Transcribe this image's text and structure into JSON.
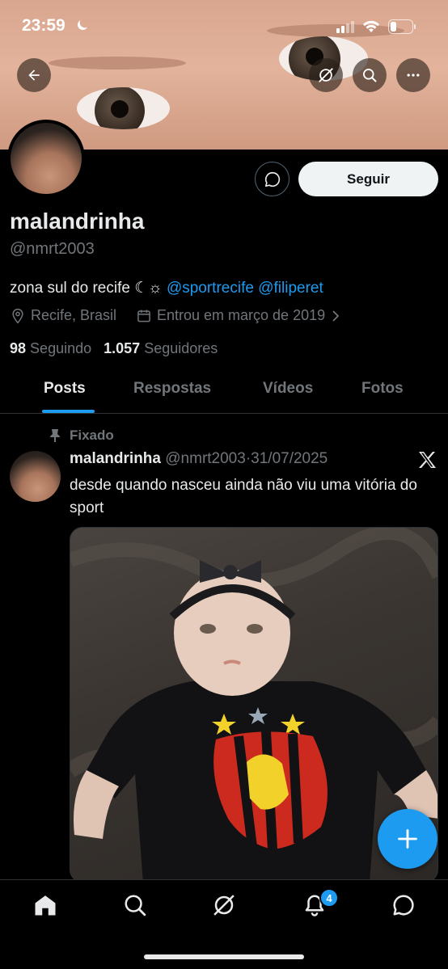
{
  "status_bar": {
    "time": "23:59"
  },
  "profile": {
    "name": "malandrinha",
    "handle": "@nmrt2003",
    "bio_text": "zona sul do recife ☾☼ ",
    "bio_mentions": [
      "@sportrecife",
      "@filiperet"
    ],
    "location": "Recife, Brasil",
    "joined": "Entrou em março de 2019",
    "following_count": "98",
    "following_label": "Seguindo",
    "followers_count": "1.057",
    "followers_label": "Seguidores",
    "follow_label": "Seguir"
  },
  "tabs": [
    {
      "label": "Posts",
      "active": true
    },
    {
      "label": "Respostas",
      "active": false
    },
    {
      "label": "Vídeos",
      "active": false
    },
    {
      "label": "Fotos",
      "active": false
    }
  ],
  "post": {
    "pinned_label": "Fixado",
    "author_name": "malandrinha",
    "author_handle": "@nmrt2003",
    "separator": "·",
    "date": "31/07/2025",
    "text": "desde quando nasceu ainda não viu uma vitória do sport"
  },
  "bottom_nav": {
    "notifications_badge": "4"
  },
  "colors": {
    "accent": "#1d9bf0",
    "background": "#000000",
    "secondary_text": "#71767b"
  },
  "icons": [
    "back-arrow-icon",
    "grok-icon",
    "search-icon",
    "more-icon",
    "message-icon",
    "location-pin-icon",
    "calendar-icon",
    "chevron-right-icon",
    "pin-icon",
    "x-logo-icon",
    "plus-icon",
    "home-icon",
    "bell-icon",
    "envelope-icon"
  ]
}
